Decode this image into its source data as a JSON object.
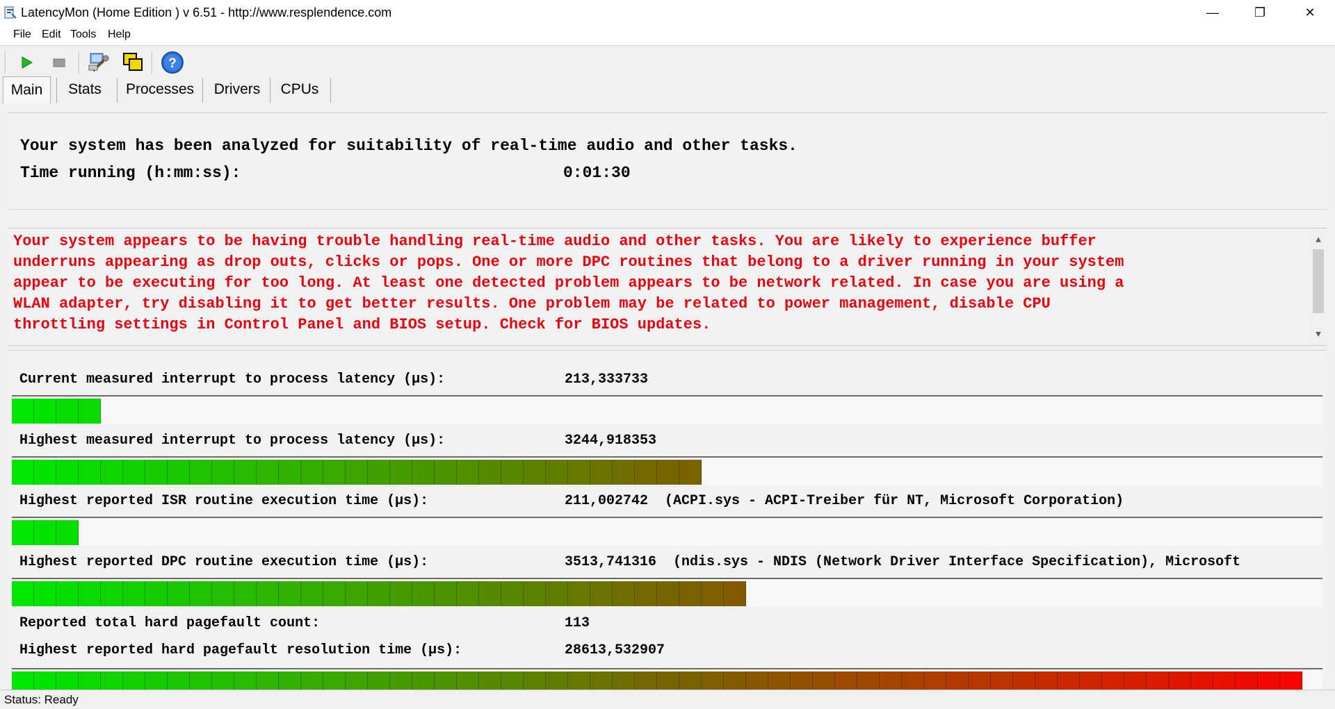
{
  "window": {
    "title": "LatencyMon  (Home Edition )  v 6.51 - http://www.resplendence.com",
    "minimize": "—",
    "restore": "❐",
    "close": "✕"
  },
  "menu": [
    "File",
    "Edit",
    "Tools",
    "Help"
  ],
  "toolbar": {
    "icons": [
      "play-icon",
      "stop-icon",
      "tools-icon",
      "windows-icon",
      "help-icon"
    ],
    "help_glyph": "?"
  },
  "tabs": [
    "Main",
    "Stats",
    "Processes",
    "Drivers",
    "CPUs"
  ],
  "summary": {
    "line1": "Your system has been analyzed for suitability of real-time audio and other tasks.",
    "time_label": "Time running (h:mm:ss):",
    "time_value": "0:01:30"
  },
  "warning": {
    "text": "Your system appears to be having trouble handling real-time audio and other tasks. You are likely to experience buffer\nunderruns appearing as drop outs, clicks or pops. One or more DPC routines that belong to a driver running in your system\nappear to be executing for too long. At least one detected problem appears to be network related. In case you are using a\nWLAN adapter, try disabling it to get better results. One problem may be related to power management, disable CPU\nthrottling settings in Control Panel and BIOS setup. Check for BIOS updates.",
    "scroll_up": "▲",
    "scroll_down": "▼",
    "color": "#e8000e"
  },
  "metrics": [
    {
      "label": "Current measured interrupt to process latency (µs):",
      "value": "213,333733",
      "level": 0.065
    },
    {
      "label": "Highest measured interrupt to process latency (µs):",
      "value": "3244,918353",
      "level": 0.53
    },
    {
      "label": "Highest reported ISR routine execution time (µs):",
      "value": "211,002742  (ACPI.sys - ACPI-Treiber für NT, Microsoft Corporation)",
      "level": 0.05
    },
    {
      "label": "Highest reported DPC routine execution time (µs):",
      "value": "3513,741316  (ndis.sys - NDIS (Network Driver Interface Specification), Microsoft",
      "level": 0.56
    },
    {
      "label": "Reported total hard pagefault count:",
      "value": "113"
    },
    {
      "label": "Highest reported hard pagefault resolution time (µs):",
      "value": "28613,532907",
      "level": 0.98
    }
  ],
  "status": "Status: Ready"
}
